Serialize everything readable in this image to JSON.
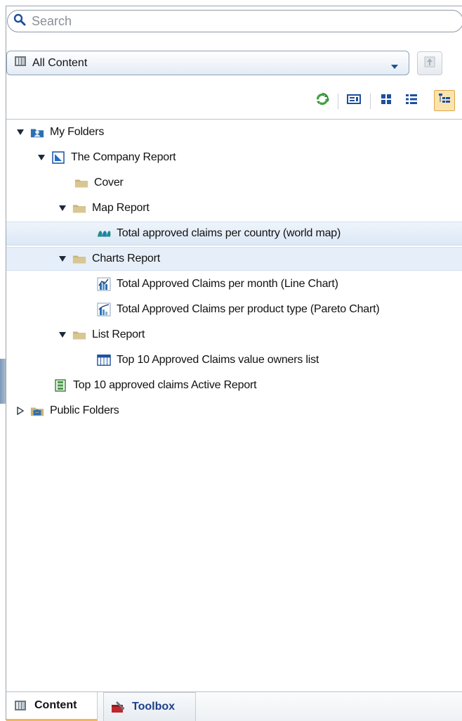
{
  "search": {
    "placeholder": "Search"
  },
  "scope_dropdown": {
    "value": "All Content"
  },
  "tree": [
    {
      "label": "My Folders"
    },
    {
      "label": "The Company Report"
    },
    {
      "label": "Cover"
    },
    {
      "label": "Map Report"
    },
    {
      "label": "Total approved claims per country (world map)"
    },
    {
      "label": "Charts Report"
    },
    {
      "label": "Total Approved Claims per month (Line Chart)"
    },
    {
      "label": "Total Approved Claims per product type (Pareto Chart)"
    },
    {
      "label": "List Report"
    },
    {
      "label": "Top 10 Approved Claims value owners list"
    },
    {
      "label": "Top 10 approved claims Active Report"
    },
    {
      "label": "Public Folders"
    }
  ],
  "tabs": {
    "content": "Content",
    "toolbox": "Toolbox"
  },
  "icons": {
    "search": "search-icon",
    "scope": "content-store-icon",
    "up": "up-level-icon",
    "refresh": "refresh-icon",
    "properties": "properties-icon",
    "thumbnails": "thumbnail-view-icon",
    "details": "list-view-icon",
    "tree": "tree-view-icon"
  },
  "colors": {
    "selection": "#dce8f6",
    "active_view": "#fbe3b0",
    "folder": "#c8b37a",
    "toolbox_text": "#1e3f8a"
  }
}
